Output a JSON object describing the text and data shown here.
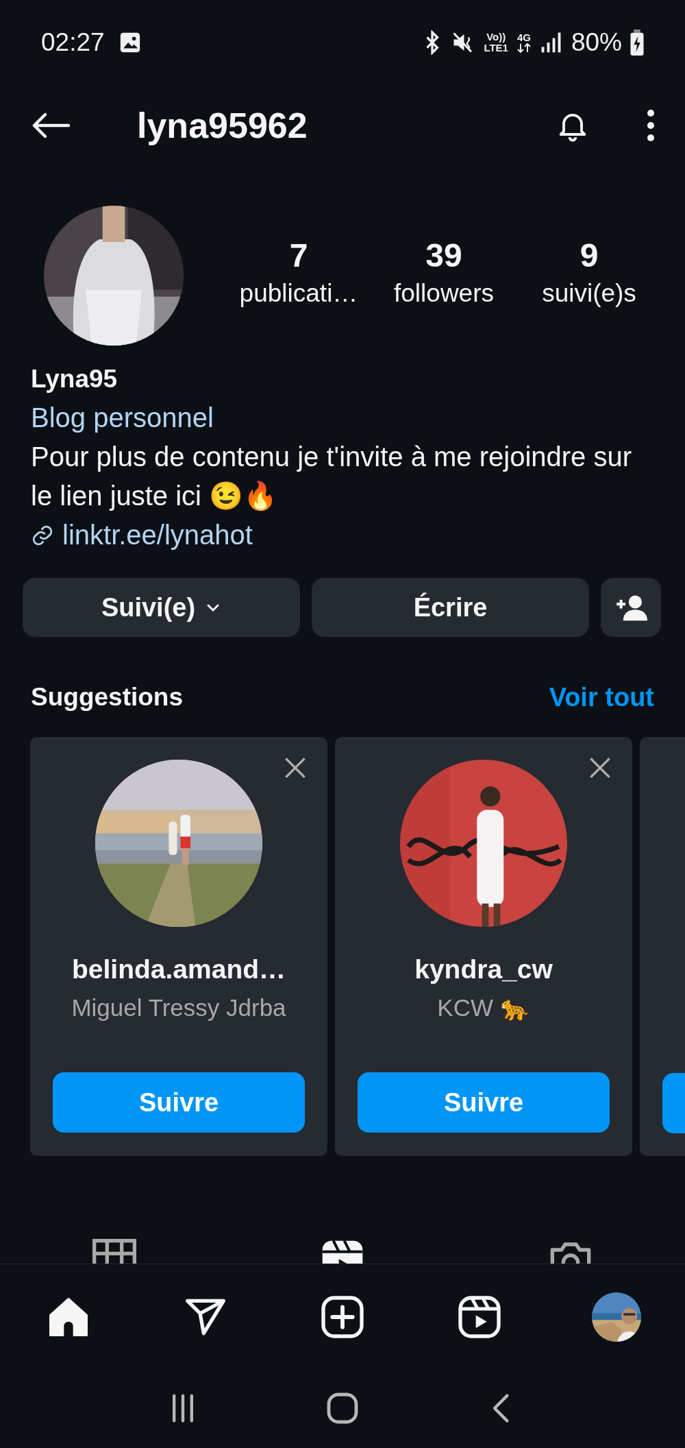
{
  "status_bar": {
    "time": "02:27",
    "volte_top": "Vo))",
    "volte_bottom": "LTE1",
    "network": "4G",
    "battery": "80%"
  },
  "header": {
    "username": "lyna95962"
  },
  "profile": {
    "stats": [
      {
        "value": "7",
        "label": "publicati…"
      },
      {
        "value": "39",
        "label": "followers"
      },
      {
        "value": "9",
        "label": "suivi(e)s"
      }
    ],
    "name": "Lyna95",
    "category": "Blog personnel",
    "bio": "Pour plus de contenu je t'invite à me rejoindre sur le lien juste ici 😉🔥",
    "link": "linktr.ee/lynahot"
  },
  "actions": {
    "follow": "Suivi(e)",
    "message": "Écrire"
  },
  "suggestions": {
    "title": "Suggestions",
    "see_all": "Voir tout",
    "cards": [
      {
        "username": "belinda.amand…",
        "subtitle": "Miguel Tressy Jdrba",
        "button": "Suivre"
      },
      {
        "username": "kyndra_cw",
        "subtitle": "KCW 🐆",
        "button": "Suivre"
      }
    ]
  },
  "profile_tabs": [
    {
      "kind": "grid",
      "selected": false
    },
    {
      "kind": "reels",
      "selected": true
    },
    {
      "kind": "tagged",
      "selected": false
    }
  ],
  "nav": [
    {
      "kind": "home"
    },
    {
      "kind": "send"
    },
    {
      "kind": "create"
    },
    {
      "kind": "reels"
    },
    {
      "kind": "profile"
    }
  ]
}
